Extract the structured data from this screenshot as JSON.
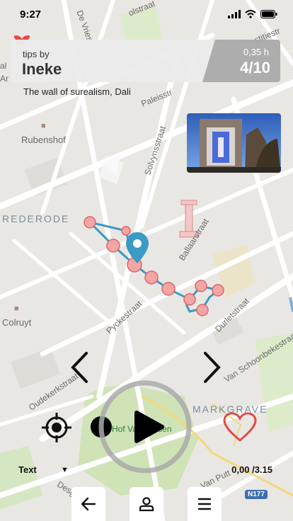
{
  "status": {
    "time": "9:27"
  },
  "header": {
    "tips_by": "tips by",
    "author": "Ineke",
    "hours": "0,35 h",
    "count": "4/10",
    "subtitle": "The wall of surealism, Dali"
  },
  "map": {
    "streets": [
      "De Vries",
      "olstraat",
      "stitiestr",
      "Paleisstr",
      "Solvynsstraat",
      "Ballaarstraat",
      "Durletstraat",
      "Pyckestraat",
      "Oudekerkstraat",
      "Van Schoonbekestraat",
      "Desg",
      "Van Putt"
    ],
    "places": [
      "Rubenshof",
      "Colruyt",
      "Hof Van Leysen"
    ],
    "districts": [
      "REDERODE",
      "MARKGRAVE"
    ],
    "road_shield": "N177",
    "left_edge_labels": [
      "al",
      "Ar"
    ]
  },
  "controls": {
    "text_label": "Text",
    "progress": "0,00 /3.15",
    "icons": {
      "prev": "chevron-left-icon",
      "next": "chevron-right-icon",
      "locate": "crosshair-icon",
      "record": "record-icon",
      "play": "play-icon",
      "favorite": "heart-icon",
      "back": "arrow-left-icon",
      "profile": "person-icon",
      "menu": "menu-icon"
    }
  },
  "colors": {
    "route": "#3a9bc5",
    "stop_fill": "#f2a5a5",
    "stop_stroke": "#e06666",
    "pin": "#3a9bc5",
    "heart": "#e34a4a"
  }
}
